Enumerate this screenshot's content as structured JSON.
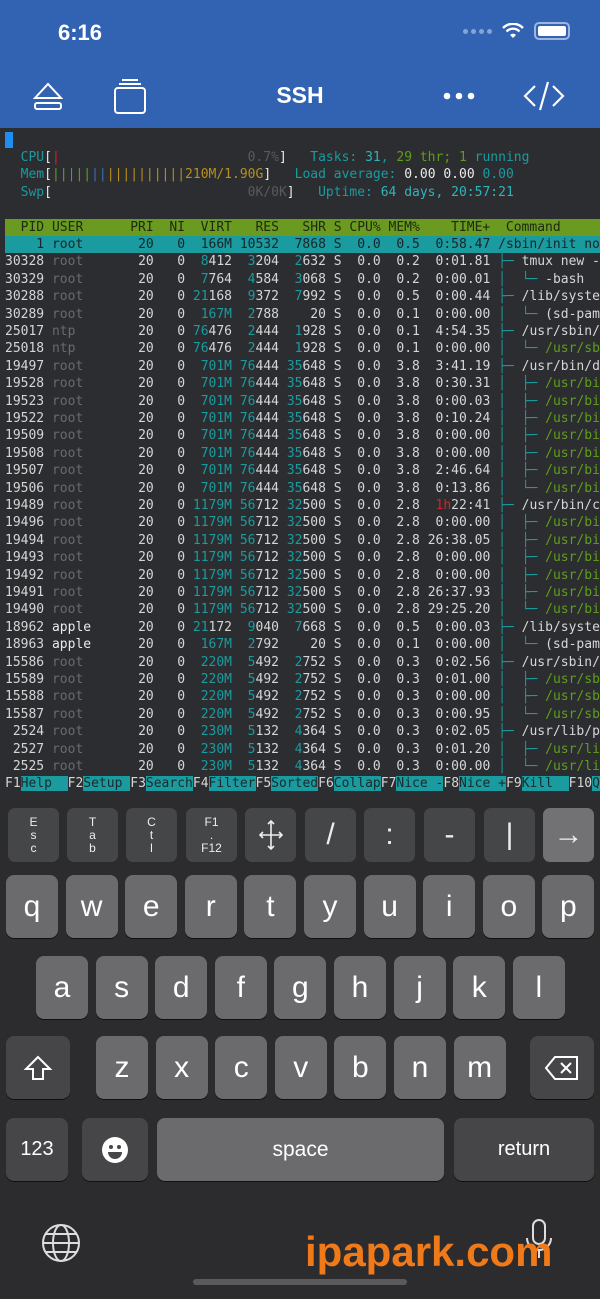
{
  "status": {
    "time": "6:16"
  },
  "nav": {
    "title": "SSH"
  },
  "meters": {
    "cpu": {
      "label": "CPU",
      "value": "0.7%"
    },
    "mem": {
      "label": "Mem",
      "value": "210M/1.90G"
    },
    "swp": {
      "label": "Swp",
      "value": "0K/0K"
    },
    "tasks": {
      "label": "Tasks: ",
      "count": "31",
      "thr": "29",
      "thr_label": " thr; ",
      "running": "1",
      "running_label": " running"
    },
    "load": {
      "label": "Load average: ",
      "v1": "0.00",
      "v2": "0.00",
      "v3": "0.00"
    },
    "uptime": {
      "label": "Uptime: ",
      "value": "64 days, 20:57:21"
    }
  },
  "columns": [
    "PID",
    "USER",
    "PRI",
    "NI",
    "VIRT",
    "RES",
    "SHR",
    "S",
    "CPU%",
    "MEM%",
    "TIME+",
    "Command"
  ],
  "processes": [
    [
      "1",
      "root",
      "20",
      "0",
      "166M",
      "10532",
      "7868",
      "S",
      "0.0",
      "0.5",
      "0:58.47",
      "",
      "/sbin/init nos",
      0,
      1
    ],
    [
      "30328",
      "root",
      "20",
      "0",
      "8412",
      "3204",
      "2632",
      "S",
      "0.0",
      "0.2",
      "0:01.81",
      "├─ ",
      "tmux new -A",
      0
    ],
    [
      "30329",
      "root",
      "20",
      "0",
      "7764",
      "4584",
      "3068",
      "S",
      "0.0",
      "0.2",
      "0:00.01",
      "│  └─ ",
      "-bash",
      0
    ],
    [
      "30288",
      "root",
      "20",
      "0",
      "21168",
      "9372",
      "7992",
      "S",
      "0.0",
      "0.5",
      "0:00.44",
      "├─ ",
      "/lib/system",
      0
    ],
    [
      "30289",
      "root",
      "20",
      "0",
      "167M",
      "2788",
      "20",
      "S",
      "0.0",
      "0.1",
      "0:00.00",
      "│  └─ ",
      "(sd-pam)",
      0
    ],
    [
      "25017",
      "ntp",
      "20",
      "0",
      "76476",
      "2444",
      "1928",
      "S",
      "0.0",
      "0.1",
      "4:54.35",
      "├─ ",
      "/usr/sbin/n",
      0
    ],
    [
      "25018",
      "ntp",
      "20",
      "0",
      "76476",
      "2444",
      "1928",
      "S",
      "0.0",
      "0.1",
      "0:00.00",
      "│  └─ ",
      "/usr/sbi",
      1
    ],
    [
      "19497",
      "root",
      "20",
      "0",
      "701M",
      "76444",
      "35648",
      "S",
      "0.0",
      "3.8",
      "3:41.19",
      "├─ ",
      "/usr/bin/do",
      0
    ],
    [
      "19528",
      "root",
      "20",
      "0",
      "701M",
      "76444",
      "35648",
      "S",
      "0.0",
      "3.8",
      "0:30.31",
      "│  ├─ ",
      "/usr/bin",
      1
    ],
    [
      "19523",
      "root",
      "20",
      "0",
      "701M",
      "76444",
      "35648",
      "S",
      "0.0",
      "3.8",
      "0:00.03",
      "│  ├─ ",
      "/usr/bin",
      1
    ],
    [
      "19522",
      "root",
      "20",
      "0",
      "701M",
      "76444",
      "35648",
      "S",
      "0.0",
      "3.8",
      "0:10.24",
      "│  ├─ ",
      "/usr/bin",
      1
    ],
    [
      "19509",
      "root",
      "20",
      "0",
      "701M",
      "76444",
      "35648",
      "S",
      "0.0",
      "3.8",
      "0:00.00",
      "│  ├─ ",
      "/usr/bin",
      1
    ],
    [
      "19508",
      "root",
      "20",
      "0",
      "701M",
      "76444",
      "35648",
      "S",
      "0.0",
      "3.8",
      "0:00.00",
      "│  ├─ ",
      "/usr/bin",
      1
    ],
    [
      "19507",
      "root",
      "20",
      "0",
      "701M",
      "76444",
      "35648",
      "S",
      "0.0",
      "3.8",
      "2:46.64",
      "│  ├─ ",
      "/usr/bin",
      1
    ],
    [
      "19506",
      "root",
      "20",
      "0",
      "701M",
      "76444",
      "35648",
      "S",
      "0.0",
      "3.8",
      "0:13.86",
      "│  └─ ",
      "/usr/bin",
      1
    ],
    [
      "19489",
      "root",
      "20",
      "0",
      "1179M",
      "56712",
      "32500",
      "S",
      "0.0",
      "2.8",
      "1h22:41",
      "├─ ",
      "/usr/bin/co",
      0
    ],
    [
      "19496",
      "root",
      "20",
      "0",
      "1179M",
      "56712",
      "32500",
      "S",
      "0.0",
      "2.8",
      "0:00.00",
      "│  ├─ ",
      "/usr/bin",
      1
    ],
    [
      "19494",
      "root",
      "20",
      "0",
      "1179M",
      "56712",
      "32500",
      "S",
      "0.0",
      "2.8",
      "26:38.05",
      "│  ├─ ",
      "/usr/bin",
      1
    ],
    [
      "19493",
      "root",
      "20",
      "0",
      "1179M",
      "56712",
      "32500",
      "S",
      "0.0",
      "2.8",
      "0:00.00",
      "│  ├─ ",
      "/usr/bin",
      1
    ],
    [
      "19492",
      "root",
      "20",
      "0",
      "1179M",
      "56712",
      "32500",
      "S",
      "0.0",
      "2.8",
      "0:00.00",
      "│  ├─ ",
      "/usr/bin",
      1
    ],
    [
      "19491",
      "root",
      "20",
      "0",
      "1179M",
      "56712",
      "32500",
      "S",
      "0.0",
      "2.8",
      "26:37.93",
      "│  ├─ ",
      "/usr/bin",
      1
    ],
    [
      "19490",
      "root",
      "20",
      "0",
      "1179M",
      "56712",
      "32500",
      "S",
      "0.0",
      "2.8",
      "29:25.20",
      "│  └─ ",
      "/usr/bin",
      1
    ],
    [
      "18962",
      "apple",
      "20",
      "0",
      "21172",
      "9040",
      "7668",
      "S",
      "0.0",
      "0.5",
      "0:00.03",
      "├─ ",
      "/lib/system",
      0
    ],
    [
      "18963",
      "apple",
      "20",
      "0",
      "167M",
      "2792",
      "20",
      "S",
      "0.0",
      "0.1",
      "0:00.00",
      "│  └─ ",
      "(sd-pam)",
      0
    ],
    [
      "15586",
      "root",
      "20",
      "0",
      "220M",
      "5492",
      "2752",
      "S",
      "0.0",
      "0.3",
      "0:02.56",
      "├─ ",
      "/usr/sbin/r",
      0
    ],
    [
      "15589",
      "root",
      "20",
      "0",
      "220M",
      "5492",
      "2752",
      "S",
      "0.0",
      "0.3",
      "0:01.00",
      "│  ├─ ",
      "/usr/sbi",
      1
    ],
    [
      "15588",
      "root",
      "20",
      "0",
      "220M",
      "5492",
      "2752",
      "S",
      "0.0",
      "0.3",
      "0:00.00",
      "│  ├─ ",
      "/usr/sbi",
      1
    ],
    [
      "15587",
      "root",
      "20",
      "0",
      "220M",
      "5492",
      "2752",
      "S",
      "0.0",
      "0.3",
      "0:00.95",
      "│  └─ ",
      "/usr/sbi",
      1
    ],
    [
      "2524",
      "root",
      "20",
      "0",
      "230M",
      "5132",
      "4364",
      "S",
      "0.0",
      "0.3",
      "0:02.05",
      "├─ ",
      "/usr/lib/po",
      0
    ],
    [
      "2527",
      "root",
      "20",
      "0",
      "230M",
      "5132",
      "4364",
      "S",
      "0.0",
      "0.3",
      "0:01.20",
      "│  ├─ ",
      "/usr/lib",
      1
    ],
    [
      "2525",
      "root",
      "20",
      "0",
      "230M",
      "5132",
      "4364",
      "S",
      "0.0",
      "0.3",
      "0:00.00",
      "│  └─ ",
      "/usr/lib",
      1
    ]
  ],
  "fkeys": [
    [
      "F1",
      "Help  "
    ],
    [
      "F2",
      "Setup "
    ],
    [
      "F3",
      "Search"
    ],
    [
      "F4",
      "Filter"
    ],
    [
      "F5",
      "Sorted"
    ],
    [
      "F6",
      "Collap"
    ],
    [
      "F7",
      "Nice -"
    ],
    [
      "F8",
      "Nice +"
    ],
    [
      "F9",
      "Kill  "
    ],
    [
      "F10",
      "Qu"
    ]
  ],
  "toolbar_keys": [
    [
      "E",
      "s",
      "c"
    ],
    [
      "T",
      "a",
      "b"
    ],
    [
      "C",
      "t",
      "l"
    ],
    [
      "F1",
      ".",
      "F12"
    ],
    [
      "arrows"
    ],
    [
      "/"
    ],
    [
      ":"
    ],
    [
      "-"
    ],
    [
      "|"
    ],
    [
      "→"
    ]
  ],
  "keyboard": {
    "row1": [
      "q",
      "w",
      "e",
      "r",
      "t",
      "y",
      "u",
      "i",
      "o",
      "p"
    ],
    "row2": [
      "a",
      "s",
      "d",
      "f",
      "g",
      "h",
      "j",
      "k",
      "l"
    ],
    "row3": [
      "z",
      "x",
      "c",
      "v",
      "b",
      "n",
      "m"
    ],
    "numbers": "123",
    "space": "space",
    "return": "return"
  },
  "watermark": "ipapark.com"
}
